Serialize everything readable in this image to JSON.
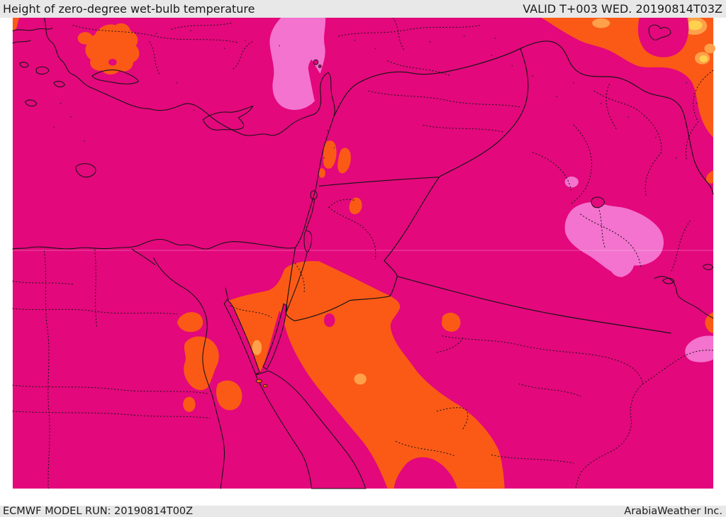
{
  "header": {
    "title": "Height of zero-degree wet-bulb temperature",
    "valid_label": "VALID T+003 WED. 20190814T03Z"
  },
  "footer": {
    "model_run_label": "ECMWF MODEL RUN: 20190814T00Z",
    "credit": "ArabiaWeather Inc."
  },
  "map": {
    "type": "filled-contour weather map of the Middle East",
    "colors": {
      "gray-bar": "#e8e8e8",
      "bar-text": "#1b1b1b",
      "magenta": "#e3087c",
      "orange": "#fa5a16",
      "light-orange": "#ffa04a",
      "yellow": "#ffd24e",
      "pink": "#f373ce",
      "line": "#141414",
      "graticule": "rgba(255,255,255,0.32)"
    }
  }
}
